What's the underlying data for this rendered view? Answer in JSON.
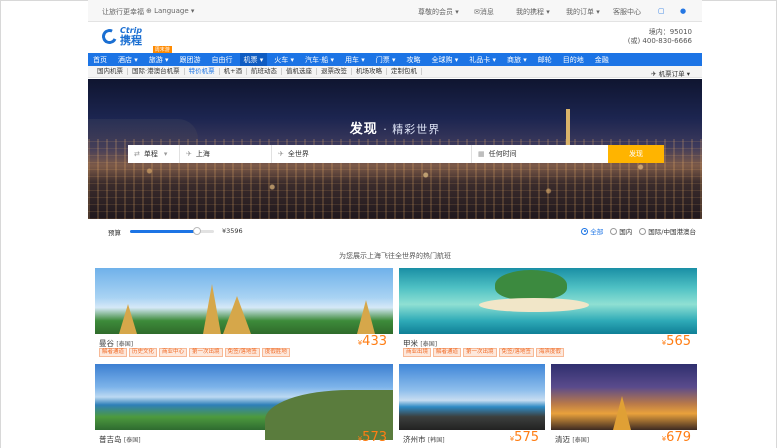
{
  "topbar": {
    "left": "让旅行更幸福",
    "language": "Language",
    "member": "尊敬的会员",
    "messages": "消息",
    "my_trip": "我的携程",
    "my_orders": "我的订单",
    "service": "客服中心"
  },
  "logo": {
    "en": "Ctrip",
    "cn": "携程"
  },
  "hotline": {
    "line1": "境内：95010",
    "line2": "(或) 400-830-6666"
  },
  "nav": {
    "items": [
      "首页",
      "酒店",
      "旅游",
      "跟团游",
      "自由行",
      "机票",
      "火车",
      "汽车·船",
      "用车",
      "门票",
      "攻略",
      "全球购",
      "礼品卡",
      "商旅",
      "邮轮",
      "目的地",
      "金融"
    ],
    "badge": "周末游"
  },
  "subnav": {
    "items": [
      "国内机票",
      "国际·港澳台机票",
      "特价机票",
      "机+酒",
      "航班动态",
      "值机选座",
      "退票改签",
      "机场攻略",
      "定制包机"
    ],
    "right": "机票订单"
  },
  "hero": {
    "title_bold": "发现",
    "title_thin": "精彩世界",
    "search": {
      "trip_type": "单程",
      "from": "上海",
      "to": "全世界",
      "date": "任何时间",
      "button": "发现"
    }
  },
  "filter": {
    "budget_label": "预算",
    "budget_value": "¥3596",
    "budget_fraction": 0.8,
    "options": [
      "全部",
      "国内",
      "国际/中国港澳台"
    ],
    "selected": 0
  },
  "section_title": "为您展示上海飞往全世界的热门航班",
  "cards": [
    {
      "name": "曼谷",
      "country": "[泰国]",
      "price": "433",
      "tags": [
        "解者通道",
        "历史文化",
        "商业中心",
        "第一次出境",
        "免签/落地签",
        "度假胜地"
      ]
    },
    {
      "name": "甲米",
      "country": "[泰国]",
      "price": "565",
      "tags": [
        "商业出境",
        "解者通道",
        "第一次出境",
        "免签/落地签",
        "海滨度假"
      ]
    },
    {
      "name": "普吉岛",
      "country": "[泰国]",
      "price": "573",
      "tags": []
    },
    {
      "name": "济州市",
      "country": "[韩国]",
      "price": "575",
      "tags": []
    },
    {
      "name": "清迈",
      "country": "[泰国]",
      "price": "679",
      "tags": []
    }
  ],
  "currency": "¥",
  "colors": {
    "brand": "#1c74e5",
    "price": "#ff7d13",
    "search_button": "#ffb400"
  }
}
